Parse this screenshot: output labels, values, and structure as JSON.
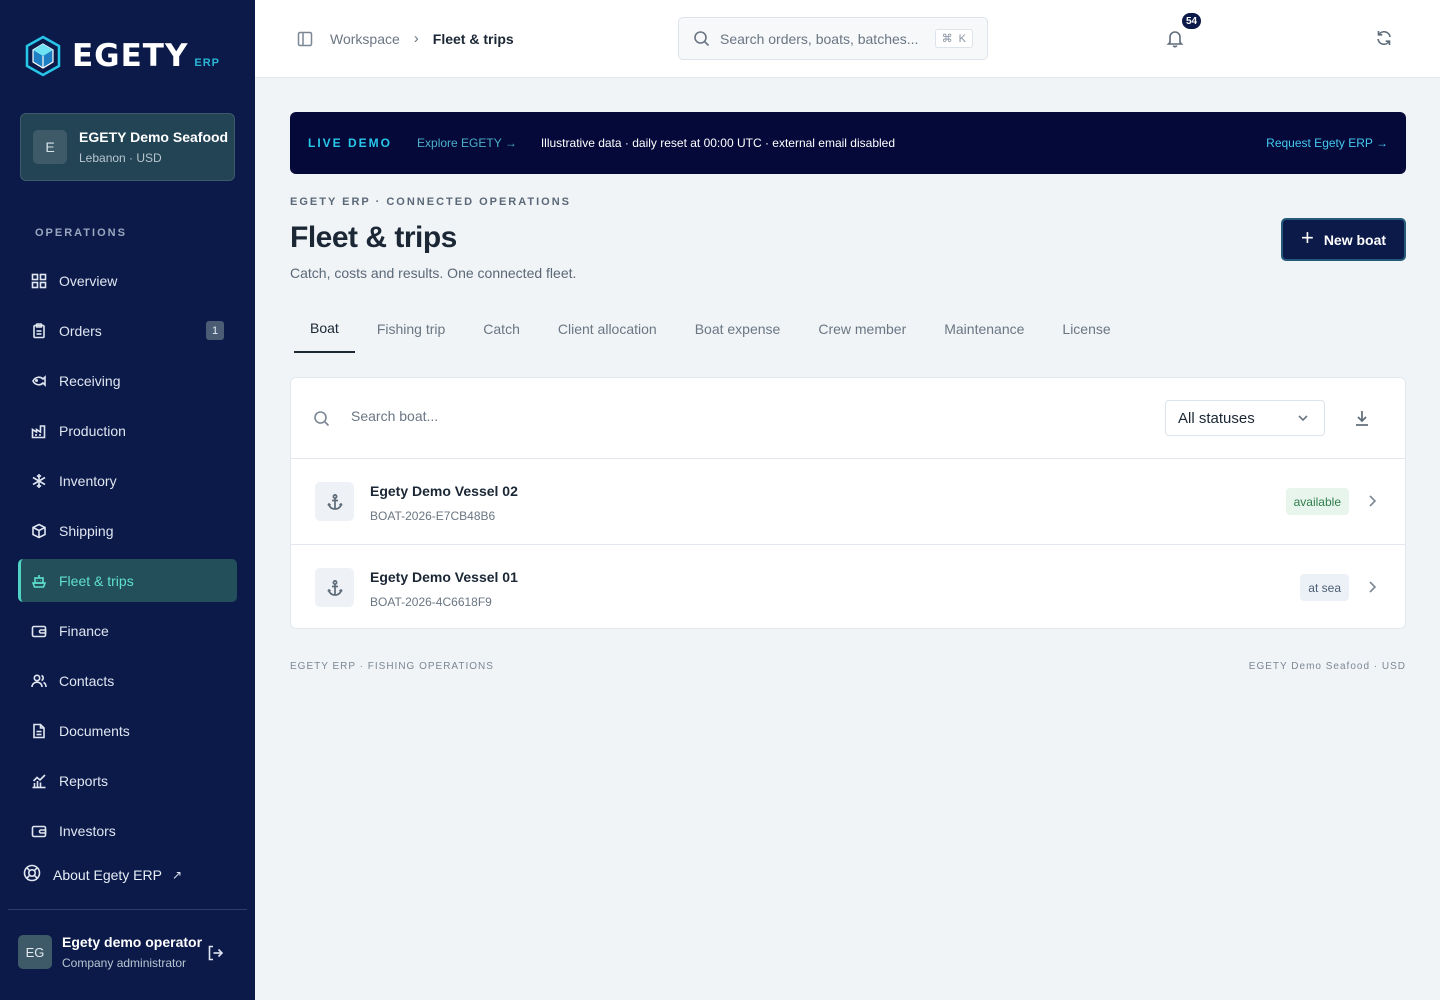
{
  "brand": {
    "name": "EGETY",
    "suffix": "ERP"
  },
  "company": {
    "initial": "E",
    "name": "EGETY Demo Seafood",
    "meta": "Lebanon · USD"
  },
  "sidebar": {
    "heading": "OPERATIONS",
    "items": [
      {
        "label": "Overview",
        "icon": "grid-icon"
      },
      {
        "label": "Orders",
        "icon": "clipboard-icon",
        "badge": "1"
      },
      {
        "label": "Receiving",
        "icon": "fish-icon"
      },
      {
        "label": "Production",
        "icon": "factory-icon"
      },
      {
        "label": "Inventory",
        "icon": "snowflake-icon"
      },
      {
        "label": "Shipping",
        "icon": "package-icon"
      },
      {
        "label": "Fleet & trips",
        "icon": "ship-icon",
        "active": true
      },
      {
        "label": "Finance",
        "icon": "wallet-icon"
      },
      {
        "label": "Contacts",
        "icon": "users-icon"
      },
      {
        "label": "Documents",
        "icon": "document-icon"
      },
      {
        "label": "Reports",
        "icon": "chart-icon"
      },
      {
        "label": "Investors",
        "icon": "wallet-icon"
      }
    ],
    "about": {
      "label": "About Egety ERP",
      "ext": "↗"
    }
  },
  "user": {
    "initials": "EG",
    "name": "Egety demo operator",
    "role": "Company administrator"
  },
  "topbar": {
    "breadcrumb": [
      "Workspace",
      "Fleet & trips"
    ],
    "search_placeholder": "Search orders, boats, batches...",
    "shortcut": [
      "⌘",
      "K"
    ],
    "notifications": "54"
  },
  "banner": {
    "tag": "LIVE DEMO",
    "explore": "Explore EGETY →",
    "message": "Illustrative data · daily reset at 00:00 UTC · external email disabled",
    "request": "Request Egety ERP →"
  },
  "page": {
    "eyebrow": "EGETY ERP · CONNECTED OPERATIONS",
    "title": "Fleet & trips",
    "subtitle": "Catch, costs and results. One connected fleet.",
    "new_button": "New boat"
  },
  "tabs": [
    "Boat",
    "Fishing trip",
    "Catch",
    "Client allocation",
    "Boat expense",
    "Crew member",
    "Maintenance",
    "License"
  ],
  "list": {
    "search_placeholder": "Search boat...",
    "status_filter": "All statuses",
    "rows": [
      {
        "name": "Egety Demo Vessel 02",
        "code": "BOAT-2026-E7CB48B6",
        "status": "available"
      },
      {
        "name": "Egety Demo Vessel 01",
        "code": "BOAT-2026-4C6618F9",
        "status": "at sea"
      }
    ]
  },
  "footer": {
    "left": "EGETY ERP · FISHING OPERATIONS",
    "right": "EGETY Demo Seafood · USD"
  },
  "colors": {
    "sidebar": "#0c1a4a",
    "accent": "#4fd3c4",
    "banner": "#05093a",
    "primary_button": "#0c1a4a"
  }
}
